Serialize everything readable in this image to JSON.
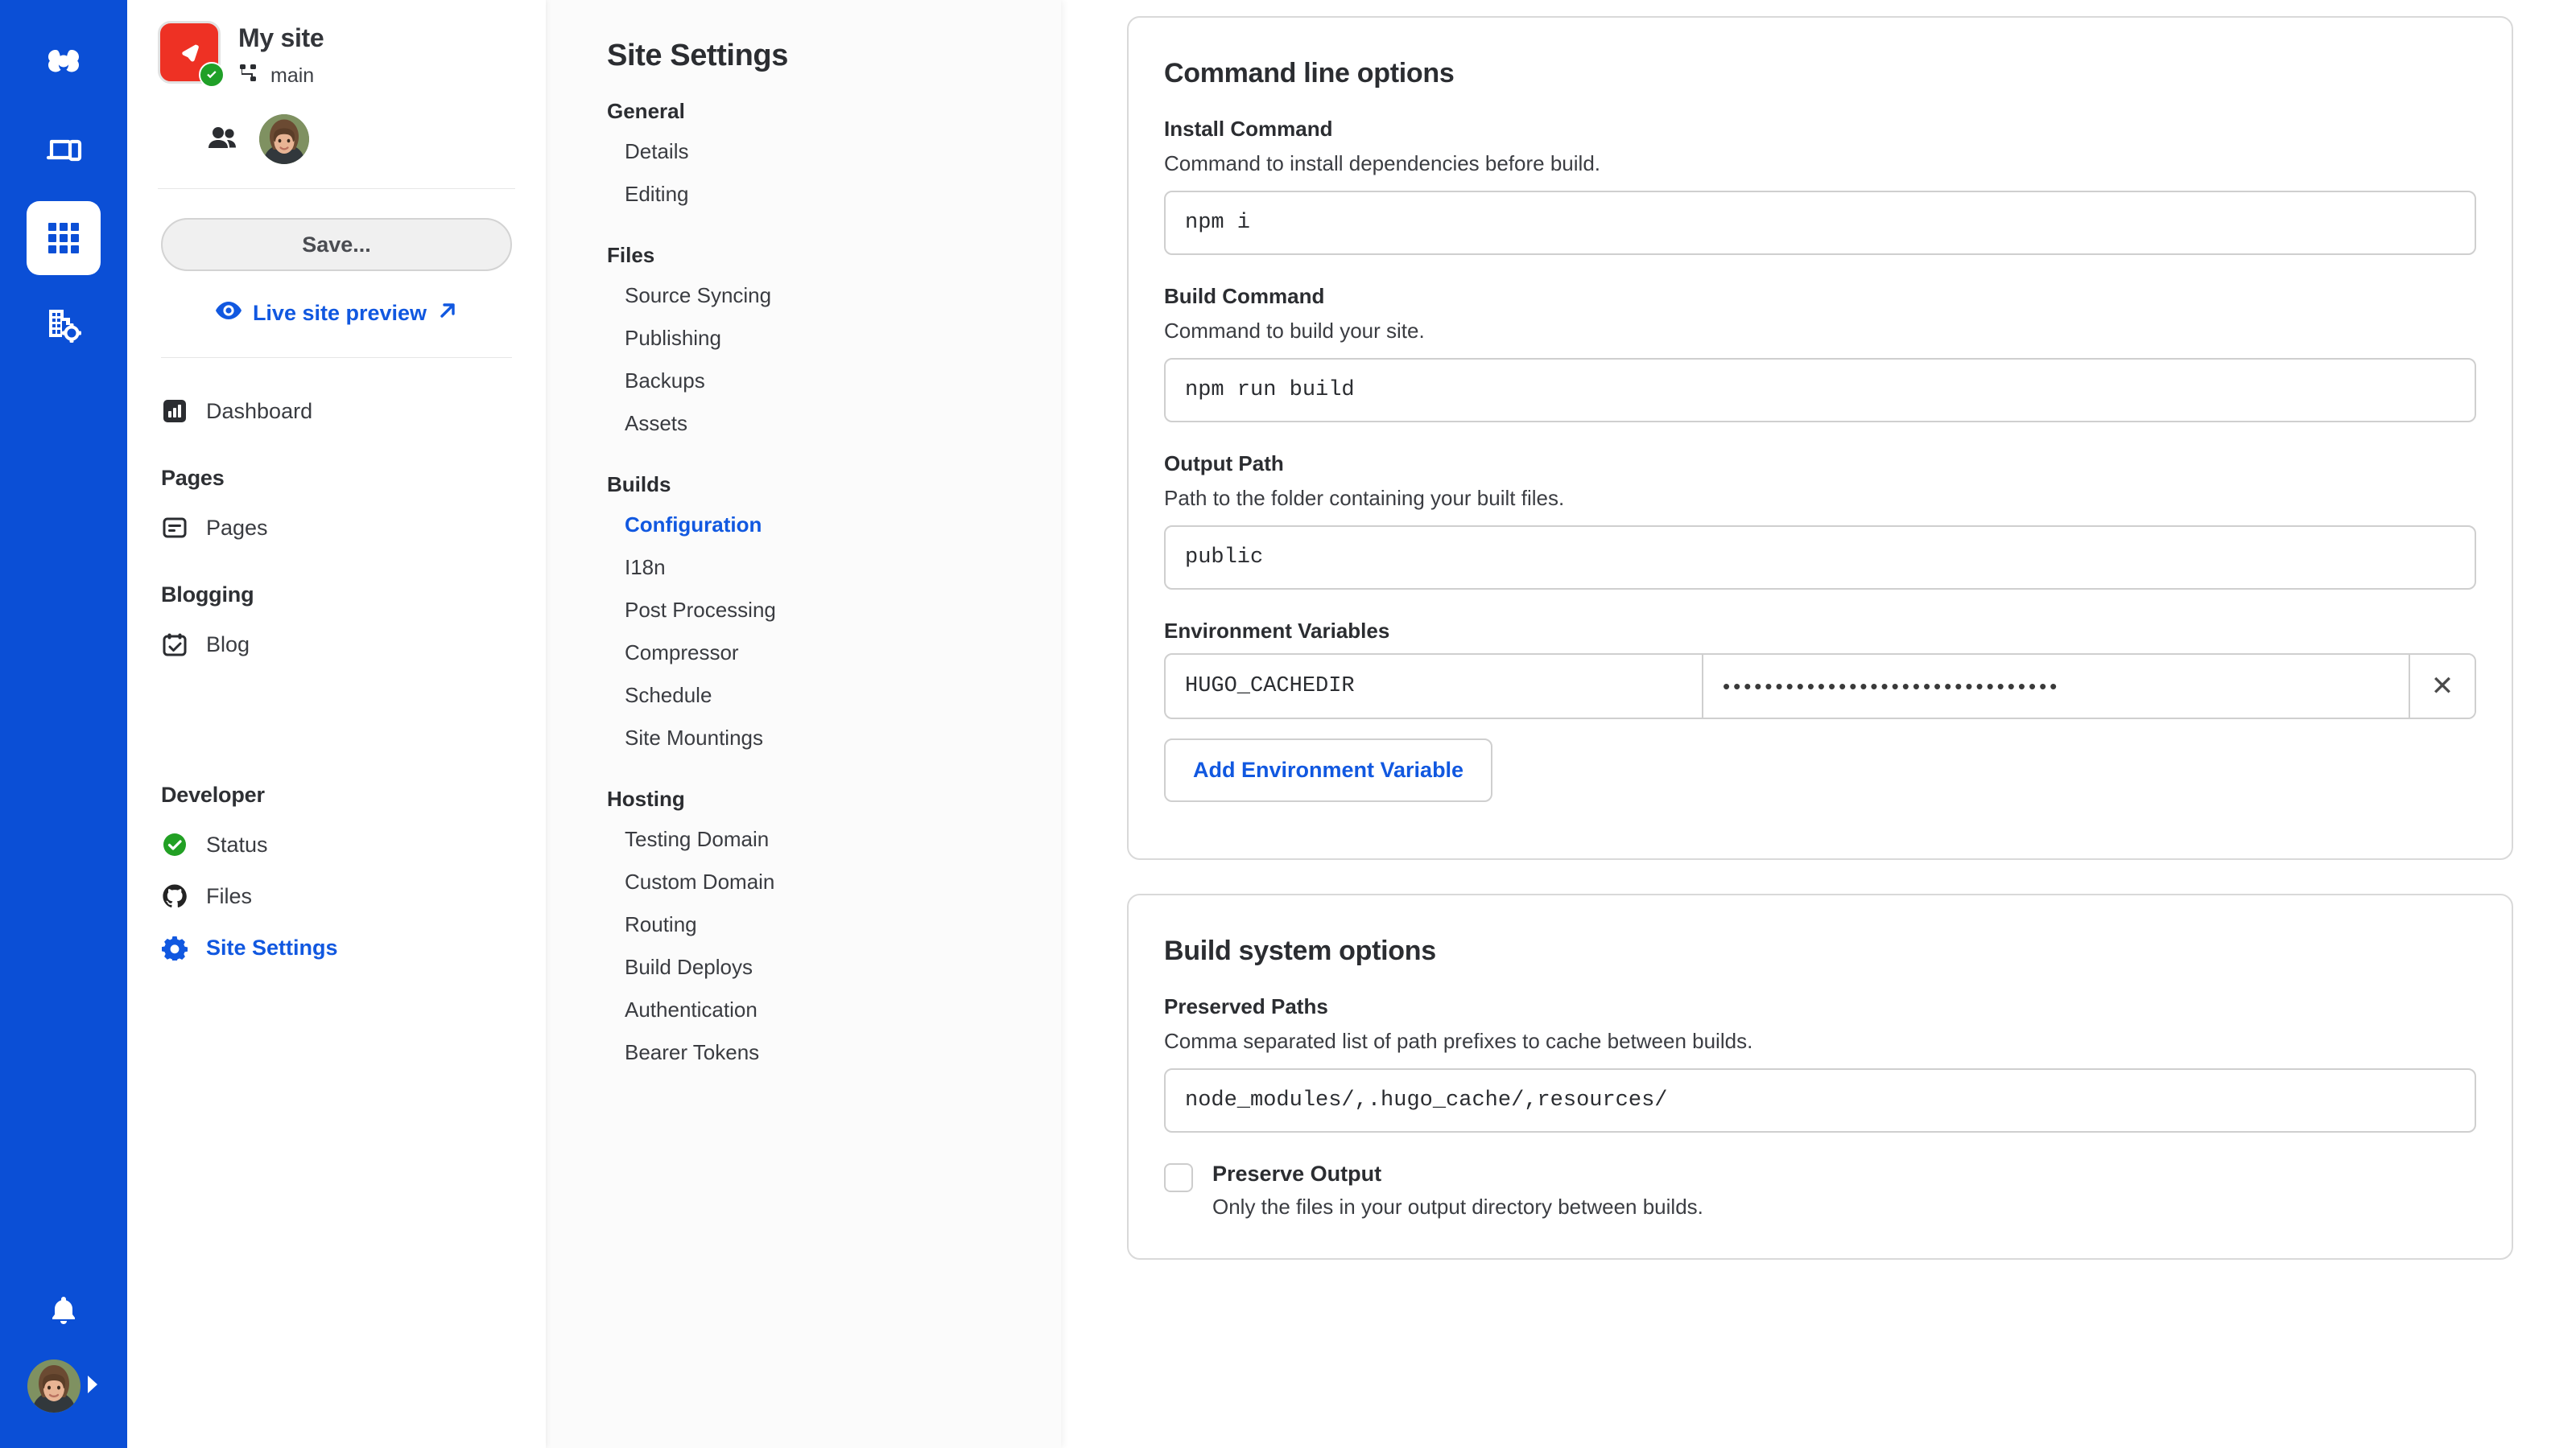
{
  "rail": {
    "icons": [
      {
        "name": "brand-logo-icon",
        "label": "CloudCannon"
      },
      {
        "name": "devices-icon",
        "label": "Devices"
      },
      {
        "name": "apps-grid-icon",
        "label": "Apps",
        "active": true
      },
      {
        "name": "organisation-settings-icon",
        "label": "Organisation settings"
      }
    ],
    "bell_label": "Notifications",
    "avatar_label": "Account menu"
  },
  "site": {
    "name": "My site",
    "branch": "main",
    "status_badge": "published",
    "members_label": "Site members",
    "save_label": "Save...",
    "preview_label": "Live site preview"
  },
  "sidebar": {
    "items": [
      {
        "label": "Dashboard",
        "icon": "dashboard-chart-icon"
      }
    ],
    "groups": [
      {
        "title": "Pages",
        "items": [
          {
            "label": "Pages",
            "icon": "page-icon"
          }
        ]
      },
      {
        "title": "Blogging",
        "items": [
          {
            "label": "Blog",
            "icon": "calendar-check-icon"
          }
        ]
      },
      {
        "title": "Developer",
        "items": [
          {
            "label": "Status",
            "icon": "status-check-icon"
          },
          {
            "label": "Files",
            "icon": "github-icon"
          },
          {
            "label": "Site Settings",
            "icon": "gear-icon",
            "selected": true
          }
        ]
      }
    ]
  },
  "settings_nav": {
    "title": "Site Settings",
    "groups": [
      {
        "title": "General",
        "items": [
          {
            "label": "Details"
          },
          {
            "label": "Editing"
          }
        ]
      },
      {
        "title": "Files",
        "items": [
          {
            "label": "Source Syncing"
          },
          {
            "label": "Publishing"
          },
          {
            "label": "Backups"
          },
          {
            "label": "Assets"
          }
        ]
      },
      {
        "title": "Builds",
        "items": [
          {
            "label": "Configuration",
            "active": true
          },
          {
            "label": "I18n"
          },
          {
            "label": "Post Processing"
          },
          {
            "label": "Compressor"
          },
          {
            "label": "Schedule"
          },
          {
            "label": "Site Mountings"
          }
        ]
      },
      {
        "title": "Hosting",
        "items": [
          {
            "label": "Testing Domain"
          },
          {
            "label": "Custom Domain"
          },
          {
            "label": "Routing"
          },
          {
            "label": "Build Deploys"
          },
          {
            "label": "Authentication"
          },
          {
            "label": "Bearer Tokens"
          }
        ]
      }
    ]
  },
  "command_line_card": {
    "title": "Command line options",
    "install": {
      "label": "Install Command",
      "help": "Command to install dependencies before build.",
      "value": "npm i"
    },
    "build": {
      "label": "Build Command",
      "help": "Command to build your site.",
      "value": "npm run build"
    },
    "output": {
      "label": "Output Path",
      "help": "Path to the folder containing your built files.",
      "value": "public"
    },
    "env": {
      "label": "Environment Variables",
      "rows": [
        {
          "key": "HUGO_CACHEDIR",
          "value_masked": "••••••••••••••••••••••••••••••••",
          "delete_label": "✕"
        }
      ],
      "add_label": "Add Environment Variable"
    }
  },
  "build_system_card": {
    "title": "Build system options",
    "preserved_paths": {
      "label": "Preserved Paths",
      "help": "Comma separated list of path prefixes to cache between builds.",
      "value": "node_modules/,.hugo_cache/,resources/"
    },
    "preserve_output": {
      "label": "Preserve Output",
      "help": "Only the files in your output directory between builds.",
      "checked": false
    }
  },
  "colors": {
    "rail_blue": "#0b4fd6",
    "accent_blue": "#1158e0",
    "site_logo_red": "#ee3124",
    "status_green": "#20a028",
    "border_grey": "#d9d9d9"
  }
}
